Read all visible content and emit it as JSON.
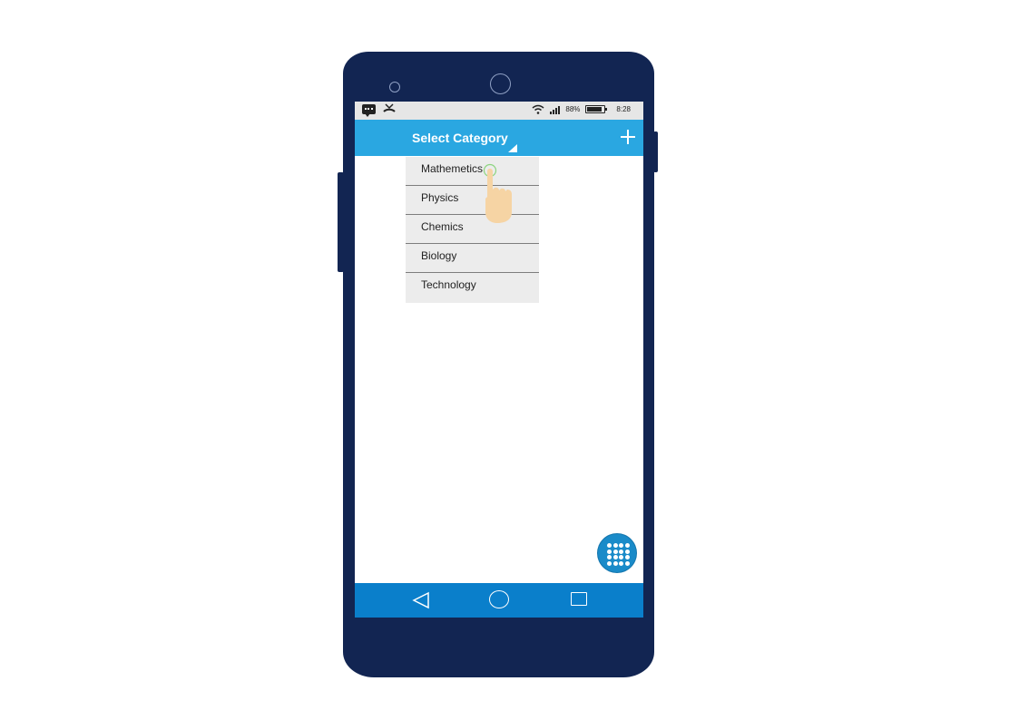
{
  "status_bar": {
    "battery_percent": "88%",
    "time": "8:28",
    "icons": [
      "message-icon",
      "missed-call-icon",
      "wifi-icon",
      "signal-icon",
      "battery-icon"
    ]
  },
  "app_bar": {
    "title": "Select Category",
    "add_icon": "plus-icon"
  },
  "dropdown": {
    "items": [
      {
        "label": "Mathemetics"
      },
      {
        "label": "Physics"
      },
      {
        "label": "Chemics"
      },
      {
        "label": "Biology"
      },
      {
        "label": "Technology"
      }
    ]
  },
  "fab": {
    "icon": "apps-grid-icon"
  },
  "nav_bar": {
    "buttons": [
      "back-icon",
      "home-icon",
      "recents-icon"
    ]
  },
  "colors": {
    "phone_body": "#122552",
    "app_bar": "#2aa7e1",
    "nav_bar": "#0a7fcb",
    "fab": "#1a8bc9",
    "dropdown_bg": "#ececec"
  }
}
